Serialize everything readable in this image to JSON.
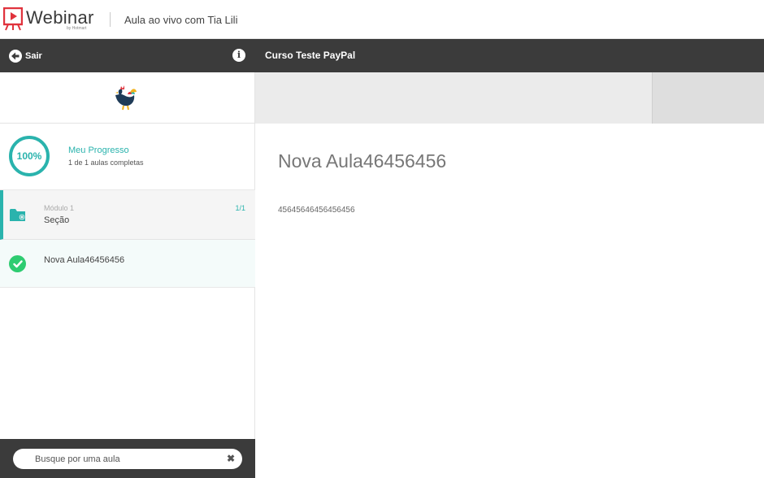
{
  "topbar": {
    "logo_icon": "presentation-screen-icon",
    "brand": "Webinar",
    "brand_sub": "by Hotmart",
    "event_title": "Aula ao vivo com Tia Lili"
  },
  "sidebar": {
    "exit_label": "Sair",
    "exit_icon": "arrow-left-circle-icon",
    "info_icon": "info-icon",
    "info_glyph": "i",
    "logo_icon": "rooster-logo-icon",
    "progress": {
      "percent_label": "100%",
      "fraction": 1.0,
      "title": "Meu Progresso",
      "subtitle": "1 de 1 aulas completas"
    },
    "modules": [
      {
        "module_label": "Módulo 1",
        "count": "1/1",
        "section": "Seção",
        "icon": "folder-icon"
      }
    ],
    "lessons": [
      {
        "name": "Nova Aula46456456",
        "status_icon": "check-circle-icon",
        "completed": true
      }
    ],
    "search": {
      "placeholder": "Busque por uma aula",
      "value": "",
      "clear_icon": "close-icon",
      "clear_glyph": "✖"
    }
  },
  "main": {
    "course_title": "Curso Teste PayPal",
    "lesson_title": "Nova Aula46456456",
    "lesson_body": "4564564645645645​6"
  },
  "colors": {
    "accent": "#2ab3ad",
    "dark_bar": "#3b3b3b",
    "success": "#2ecc71",
    "logo_red": "#e0323c"
  }
}
